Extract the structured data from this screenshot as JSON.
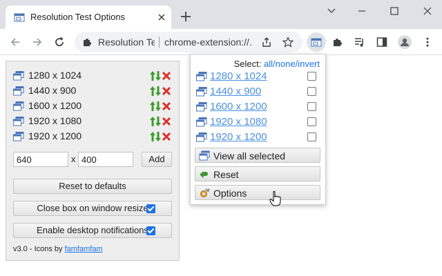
{
  "browser": {
    "tab_title": "Resolution Test Options",
    "omnibox_label": "Resolution Test",
    "omnibox_url": "chrome-extension://...",
    "accent": "#1a73e8"
  },
  "options": {
    "resolutions": [
      {
        "label": "1280 x 1024"
      },
      {
        "label": "1440 x 900"
      },
      {
        "label": "1600 x 1200"
      },
      {
        "label": "1920 x 1080"
      },
      {
        "label": "1920 x 1200"
      }
    ],
    "width_value": "640",
    "times": "x",
    "height_value": "400",
    "add_label": "Add",
    "reset_label": "Reset to defaults",
    "close_box_label": "Close box on window resize",
    "close_box_checked": true,
    "notifications_label": "Enable desktop notifications",
    "notifications_checked": true,
    "version_prefix": "v3.0 - Icons by ",
    "version_link": "famfamfam"
  },
  "popup": {
    "select_label": "Select:",
    "select_all": "all",
    "slash": "/",
    "select_none": "none",
    "select_invert": "invert",
    "resolutions": [
      {
        "label": "1280 x 1024",
        "checked": false
      },
      {
        "label": "1440 x 900",
        "checked": false
      },
      {
        "label": "1600 x 1200",
        "checked": false
      },
      {
        "label": "1920 x 1080",
        "checked": false
      },
      {
        "label": "1920 x 1200",
        "checked": false
      }
    ],
    "view_all_label": "View all selected",
    "reset_label": "Reset",
    "options_label": "Options"
  }
}
